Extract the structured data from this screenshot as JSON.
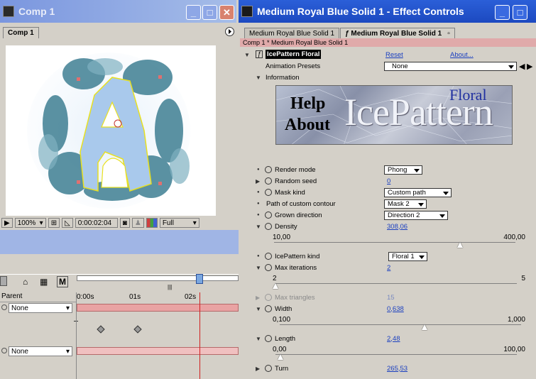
{
  "comp_window": {
    "title": "Comp 1",
    "tab": "Comp 1",
    "controls": {
      "minimize": "_",
      "maximize": "□",
      "close": "✕"
    },
    "viewbar": {
      "zoom": "100%",
      "timecode": "0:00:02:04",
      "resolution": "Full"
    }
  },
  "effect_window": {
    "title": "Medium Royal Blue Solid 1 - Effect Controls",
    "tabs": [
      "Medium Royal Blue Solid 1",
      "Medium Royal Blue Solid 1"
    ],
    "breadcrumb": "Comp 1 * Medium Royal Blue Solid 1",
    "effect_name": "IcePattern Floral",
    "reset": "Reset",
    "about": "About...",
    "animation_presets_label": "Animation Presets",
    "animation_presets_value": "None",
    "information_label": "Information",
    "banner": {
      "help": "Help",
      "about": "About",
      "brand": "IcePattern",
      "sub": "Floral"
    }
  },
  "params": {
    "render_mode": {
      "label": "Render mode",
      "value": "Phong"
    },
    "random_seed": {
      "label": "Random seed",
      "value": "0"
    },
    "mask_kind": {
      "label": "Mask kind",
      "value": "Custom path"
    },
    "path_contour": {
      "label": "Path of custom contour",
      "value": "Mask 2"
    },
    "grown_direction": {
      "label": "Grown direction",
      "value": "Direction 2"
    },
    "density": {
      "label": "Density",
      "value": "308,06",
      "min": "10,00",
      "max": "400,00",
      "level": 0.77
    },
    "kind": {
      "label": "IcePattern kind",
      "value": "Floral 1"
    },
    "max_iterations": {
      "label": "Max iterations",
      "value": "2",
      "min": "2",
      "max": "5",
      "level": 0.0
    },
    "max_triangles": {
      "label": "Max triangles",
      "value": "15"
    },
    "width": {
      "label": "Width",
      "value": "0,638",
      "min": "0,100",
      "max": "1,000",
      "level": 0.6
    },
    "length": {
      "label": "Length",
      "value": "2,48",
      "min": "0,00",
      "max": "100,00",
      "level": 0.02
    },
    "turn": {
      "label": "Turn",
      "value": "265,53"
    }
  },
  "timeline": {
    "parent_header": "Parent",
    "parent_rows": [
      "None",
      "None"
    ],
    "time_labels": [
      "0:00s",
      "01s",
      "02s"
    ],
    "toolbar_m": "M"
  },
  "colors": {
    "title_active": "#1c49c0",
    "crumb": "#e0aaaa",
    "timeline_bar": "#e9a3a3",
    "accent_blue": "#1a3fc0"
  }
}
